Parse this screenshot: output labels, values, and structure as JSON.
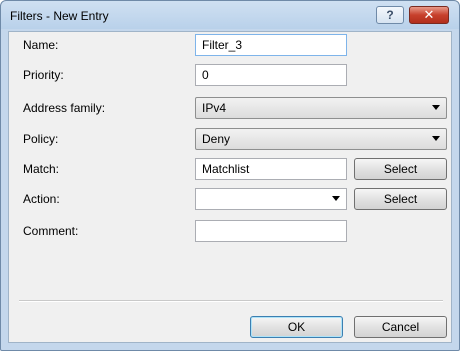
{
  "window": {
    "title": "Filters - New Entry",
    "help_icon": "question-mark-icon",
    "close_icon": "close-x-icon",
    "help_glyph": "?",
    "close_glyph": "✕"
  },
  "form": {
    "name": {
      "label": "Name:",
      "value": "Filter_3"
    },
    "priority": {
      "label": "Priority:",
      "value": "0"
    },
    "address_family": {
      "label": "Address family:",
      "value": "IPv4"
    },
    "policy": {
      "label": "Policy:",
      "value": "Deny"
    },
    "match": {
      "label": "Match:",
      "value": "Matchlist",
      "button": "Select"
    },
    "action": {
      "label": "Action:",
      "value": "",
      "button": "Select"
    },
    "comment": {
      "label": "Comment:",
      "value": ""
    }
  },
  "buttons": {
    "ok": "OK",
    "cancel": "Cancel"
  }
}
